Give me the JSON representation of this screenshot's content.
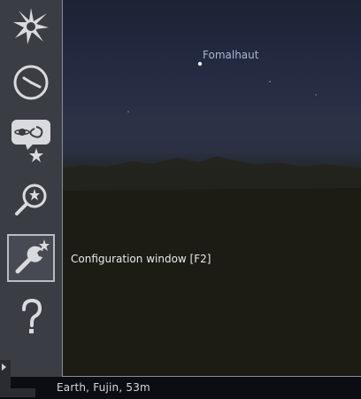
{
  "sky": {
    "star_label": "Fomalhaut"
  },
  "toolbar": {
    "items": [
      {
        "name": "location-window",
        "icon": "compass-star-icon"
      },
      {
        "name": "date-time-window",
        "icon": "clock-icon"
      },
      {
        "name": "sky-viewing-options-window",
        "icon": "galaxy-planet-icon"
      },
      {
        "name": "search-window",
        "icon": "magnifier-icon"
      },
      {
        "name": "configuration-window",
        "icon": "wrench-icon",
        "active": true
      },
      {
        "name": "help-window",
        "icon": "question-mark-icon"
      }
    ]
  },
  "tooltip": {
    "text": "Configuration window  [F2]"
  },
  "status": {
    "location_text": "Earth, Fujin, 53m"
  },
  "colors": {
    "toolbar_bg": "#3a3d44",
    "frame": "#8b8e95",
    "icon": "#d8dadd"
  }
}
